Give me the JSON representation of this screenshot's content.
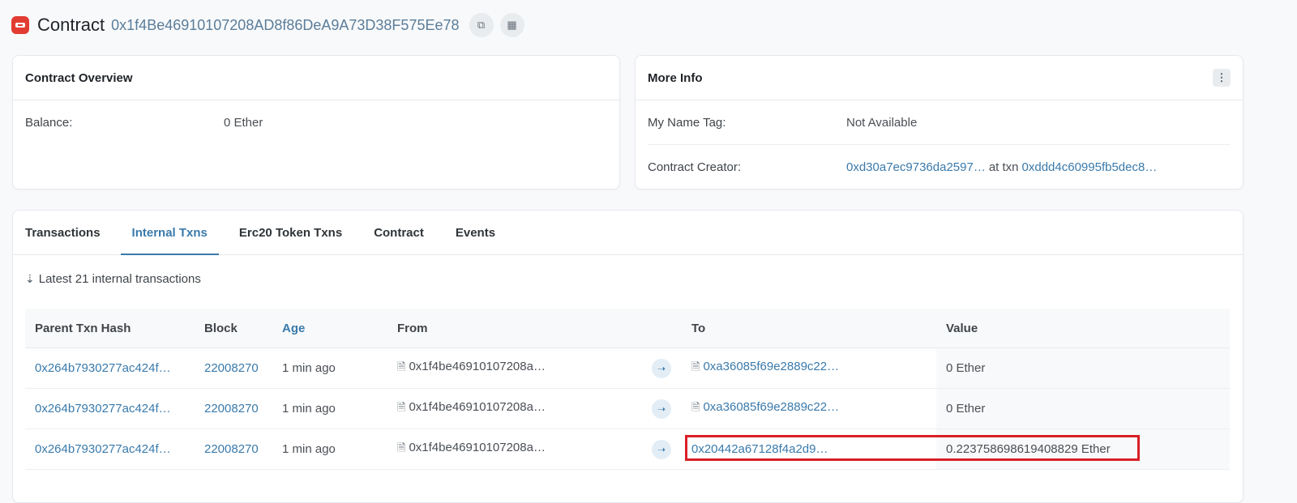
{
  "header": {
    "title": "Contract",
    "address": "0x1f4Be46910107208AD8f86DeA9A73D38F575Ee78",
    "icons": [
      "contract-logo-icon",
      "copy-icon",
      "qr-code-icon"
    ]
  },
  "overview": {
    "title": "Contract Overview",
    "balance_label": "Balance:",
    "balance_value": "0 Ether"
  },
  "more_info": {
    "title": "More Info",
    "name_tag_label": "My Name Tag:",
    "name_tag_value": "Not Available",
    "creator_label": "Contract Creator:",
    "creator_address": "0xd30a7ec9736da2597…",
    "at_txn": "at txn",
    "creator_txn": "0xddd4c60995fb5dec8…"
  },
  "tabs": [
    {
      "label": "Transactions",
      "active": false
    },
    {
      "label": "Internal Txns",
      "active": true
    },
    {
      "label": "Erc20 Token Txns",
      "active": false
    },
    {
      "label": "Contract",
      "active": false
    },
    {
      "label": "Events",
      "active": false
    }
  ],
  "summary": "Latest 21 internal transactions",
  "table": {
    "columns": [
      "Parent Txn Hash",
      "Block",
      "Age",
      "From",
      "",
      "To",
      "Value"
    ],
    "rows": [
      {
        "hash": "0x264b7930277ac424f…",
        "block": "22008270",
        "age": "1 min ago",
        "from": "0x1f4be46910107208a…",
        "to": "0xa36085f69e2889c22…",
        "to_is_contract": true,
        "value": "0 Ether"
      },
      {
        "hash": "0x264b7930277ac424f…",
        "block": "22008270",
        "age": "1 min ago",
        "from": "0x1f4be46910107208a…",
        "to": "0xa36085f69e2889c22…",
        "to_is_contract": true,
        "value": "0 Ether"
      },
      {
        "hash": "0x264b7930277ac424f…",
        "block": "22008270",
        "age": "1 min ago",
        "from": "0x1f4be46910107208a…",
        "to": "0x20442a67128f4a2d9…",
        "to_is_contract": false,
        "value": "0.223758698619408829 Ether"
      }
    ]
  },
  "colors": {
    "link": "#3a7aab",
    "highlight": "#d91f26"
  }
}
